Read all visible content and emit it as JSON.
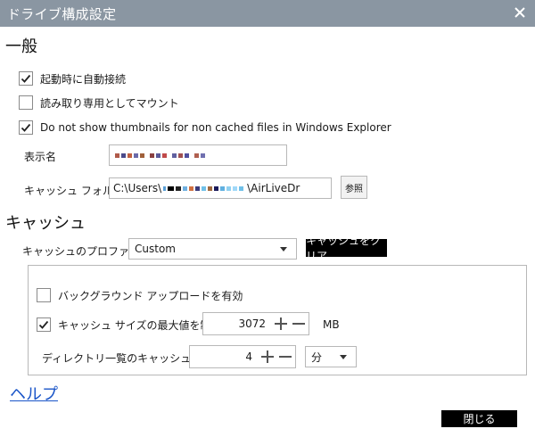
{
  "window": {
    "title": "ドライブ構成設定",
    "close_icon": "close-icon"
  },
  "general": {
    "heading": "一般",
    "auto_connect": {
      "label": "起動時に自動接続",
      "checked": true
    },
    "read_only": {
      "label": "読み取り専用としてマウント",
      "checked": false
    },
    "no_thumbnails": {
      "label": "Do not show thumbnails for non cached files in Windows Explorer",
      "checked": true
    },
    "display_name_label": "表示名",
    "cache_folder_label": "キャッシュ フォルダ",
    "cache_folder_prefix": "C:\\Users\\",
    "cache_folder_suffix": "\\AirLiveDr",
    "browse_label": "参照"
  },
  "cache": {
    "heading": "キャッシュ",
    "profile_label": "キャッシュのプロファイル",
    "profile_value": "Custom",
    "clear_label": "キャッシュをクリア",
    "background_upload": {
      "label": "バックグラウンド アップロードを有効",
      "checked": false
    },
    "limit_size": {
      "label": "キャッシュ サイズの最大値を制限",
      "checked": true
    },
    "size_value": "3072",
    "size_unit": "MB",
    "dir_cache_label": "ディレクトリ一覧のキャッシュ時間",
    "dir_cache_value": "4",
    "dir_cache_unit": "分"
  },
  "footer": {
    "help_label": "ヘルプ",
    "close_label": "閉じる"
  },
  "colors": {
    "titlebar": "#8a96a2",
    "link": "#1a55c8",
    "dark_button": "#000000"
  }
}
